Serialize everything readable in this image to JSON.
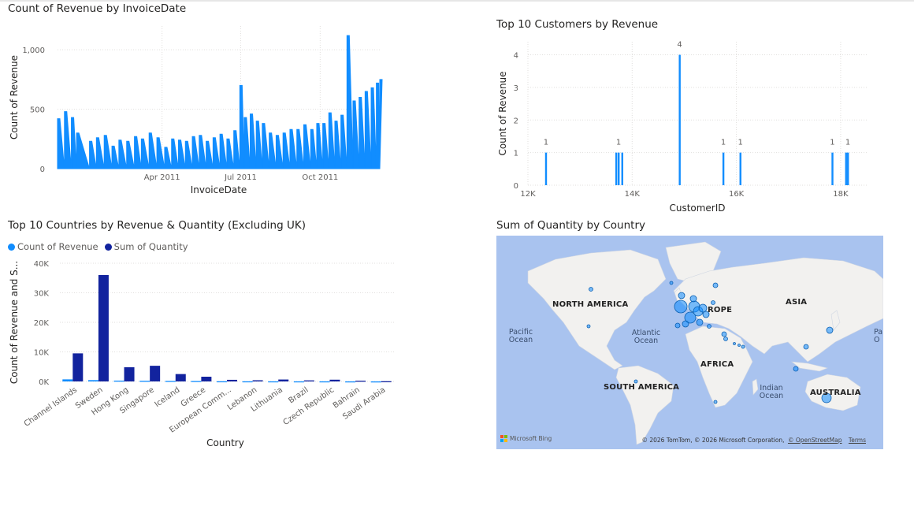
{
  "colors": {
    "series1": "#118DFF",
    "series2": "#12239E",
    "grid": "#e1dfdd",
    "map_water": "#a9c3ef",
    "map_land": "#f2f1ef",
    "bubble": "#118DFF"
  },
  "chart_data": [
    {
      "type": "line",
      "title": "Count of Revenue by InvoiceDate",
      "xlabel": "InvoiceDate",
      "ylabel": "Count of Revenue",
      "x_ticks": [
        "Apr 2011",
        "Jul 2011",
        "Oct 2011"
      ],
      "y_ticks": [
        "0",
        "500",
        "1,000"
      ],
      "ylim": [
        0,
        1200
      ],
      "xlim": [
        "2010-12-01",
        "2011-12-09"
      ],
      "grid": true,
      "series": [
        {
          "x": [
            "2010-12-01",
            "2010-12-09",
            "2010-12-17",
            "2010-12-23",
            "2011-01-07",
            "2011-01-15",
            "2011-01-24",
            "2011-02-02",
            "2011-02-10",
            "2011-02-19",
            "2011-02-28",
            "2011-03-08",
            "2011-03-17",
            "2011-03-26",
            "2011-04-04",
            "2011-04-12",
            "2011-04-20",
            "2011-04-28",
            "2011-05-06",
            "2011-05-14",
            "2011-05-22",
            "2011-05-30",
            "2011-06-07",
            "2011-06-15",
            "2011-06-23",
            "2011-06-30",
            "2011-07-05",
            "2011-07-12",
            "2011-07-19",
            "2011-07-26",
            "2011-08-03",
            "2011-08-11",
            "2011-08-19",
            "2011-08-27",
            "2011-09-04",
            "2011-09-12",
            "2011-09-20",
            "2011-09-27",
            "2011-10-04",
            "2011-10-11",
            "2011-10-18",
            "2011-10-25",
            "2011-11-01",
            "2011-11-08",
            "2011-11-15",
            "2011-11-22",
            "2011-11-29",
            "2011-12-05",
            "2011-12-09"
          ],
          "values": [
            420,
            480,
            430,
            300,
            230,
            260,
            280,
            190,
            240,
            230,
            270,
            250,
            300,
            260,
            180,
            250,
            240,
            230,
            270,
            280,
            230,
            260,
            290,
            250,
            320,
            700,
            430,
            460,
            400,
            380,
            300,
            280,
            300,
            330,
            330,
            370,
            330,
            380,
            380,
            470,
            400,
            450,
            1120,
            570,
            600,
            650,
            680,
            720,
            750
          ]
        }
      ]
    },
    {
      "type": "bar",
      "title": "Top 10 Customers by Revenue",
      "xlabel": "CustomerID",
      "ylabel": "Count of Revenue",
      "x_ticks": [
        "12K",
        "14K",
        "16K",
        "18K"
      ],
      "y_ticks": [
        "0",
        "1",
        "2",
        "3",
        "4"
      ],
      "xlim": [
        12000,
        18500
      ],
      "ylim": [
        0,
        4.4
      ],
      "grid": true,
      "x": [
        12346,
        13694,
        13740,
        13809,
        14911,
        15749,
        16076,
        17841,
        18102,
        18139
      ],
      "values": [
        1,
        1,
        1,
        1,
        4,
        1,
        1,
        1,
        1,
        1
      ],
      "data_labels": [
        {
          "x": 12346,
          "value": 1,
          "text": "1"
        },
        {
          "x": 13740,
          "value": 1,
          "text": "1"
        },
        {
          "x": 14911,
          "value": 4,
          "text": "4"
        },
        {
          "x": 15749,
          "value": 1,
          "text": "1"
        },
        {
          "x": 16076,
          "value": 1,
          "text": "1"
        },
        {
          "x": 17841,
          "value": 1,
          "text": "1"
        },
        {
          "x": 18139,
          "value": 1,
          "text": "1"
        }
      ]
    },
    {
      "type": "bar",
      "title": "Top 10 Countries by Revenue & Quantity (Excluding UK)",
      "xlabel": "Country",
      "ylabel": "Count of Revenue and S...",
      "legend": "top-left",
      "categories": [
        "Channel Islands",
        "Sweden",
        "Hong Kong",
        "Singapore",
        "Iceland",
        "Greece",
        "European Comm...",
        "Lebanon",
        "Lithuania",
        "Brazil",
        "Czech Republic",
        "Bahrain",
        "Saudi Arabia"
      ],
      "y_ticks": [
        "0K",
        "10K",
        "20K",
        "30K",
        "40K"
      ],
      "ylim": [
        0,
        40000
      ],
      "grid": true,
      "series": [
        {
          "name": "Count of Revenue",
          "values": [
            700,
            450,
            280,
            220,
            180,
            150,
            60,
            45,
            35,
            30,
            30,
            20,
            10
          ]
        },
        {
          "name": "Sum of Quantity",
          "values": [
            9500,
            36000,
            4800,
            5300,
            2500,
            1600,
            550,
            400,
            650,
            360,
            590,
            260,
            75
          ]
        }
      ]
    }
  ],
  "map": {
    "title": "Sum of Quantity by Country",
    "continents": [
      "NORTH AMERICA",
      "SOUTH AMERICA",
      "AFRICA",
      "ASIA",
      "ROPE",
      "AUSTRALIA"
    ],
    "oceans": [
      "Pacific Ocean",
      "Atlantic Ocean",
      "Indian Ocean",
      "Pa O"
    ],
    "attribution": "© 2026 TomTom, © 2026 Microsoft Corporation,",
    "attribution_osm": "© OpenStreetMap",
    "attribution_terms": "Terms",
    "provider": "Microsoft Bing"
  }
}
